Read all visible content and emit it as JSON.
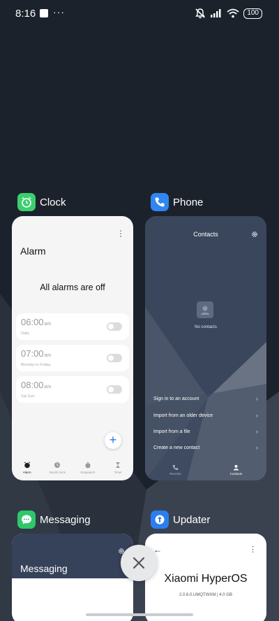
{
  "status_bar": {
    "time": "8:16",
    "more_indicator": "···",
    "battery": "100",
    "icons": [
      "notification-square-icon",
      "mute-icon",
      "cellular-signal-icon",
      "wifi-icon",
      "battery-icon"
    ]
  },
  "recent_apps": [
    {
      "name": "Clock",
      "icon": "alarm-clock-icon",
      "icon_color": "#3ccf6e",
      "screen": {
        "title": "Alarm",
        "status": "All alarms are off",
        "alarms": [
          {
            "time": "06:00",
            "period": "am",
            "days": "Daily",
            "enabled": false
          },
          {
            "time": "07:00",
            "period": "am",
            "days": "Monday to Friday",
            "enabled": false
          },
          {
            "time": "08:00",
            "period": "am",
            "days": "Sat Sun",
            "enabled": false
          }
        ],
        "nav": [
          {
            "label": "Alarm",
            "icon": "alarm-icon",
            "active": true
          },
          {
            "label": "World clock",
            "icon": "world-clock-icon",
            "active": false
          },
          {
            "label": "Stopwatch",
            "icon": "stopwatch-icon",
            "active": false
          },
          {
            "label": "Timer",
            "icon": "hourglass-icon",
            "active": false
          }
        ]
      }
    },
    {
      "name": "Phone",
      "icon": "phone-icon",
      "icon_color": "#2f86f0",
      "screen": {
        "title": "Contacts",
        "empty_text": "No contacts",
        "menu_items": [
          "Sign in to an account",
          "Import from an older device",
          "Import from a file",
          "Create a new contact"
        ],
        "nav": [
          {
            "label": "Recents",
            "icon": "phone-recents-icon",
            "active": false
          },
          {
            "label": "Contacts",
            "icon": "contacts-icon",
            "active": true
          }
        ]
      }
    },
    {
      "name": "Messaging",
      "icon": "chat-bubble-icon",
      "icon_color": "#2ec76a",
      "screen": {
        "title": "Messaging"
      }
    },
    {
      "name": "Updater",
      "icon": "updater-icon",
      "icon_color": "#2b7df0",
      "screen": {
        "title": "Xiaomi HyperOS",
        "version": "2.0.6.0.UMQTWXM | 4.0 GB"
      }
    }
  ],
  "close_button": {
    "icon": "close-x-icon"
  }
}
